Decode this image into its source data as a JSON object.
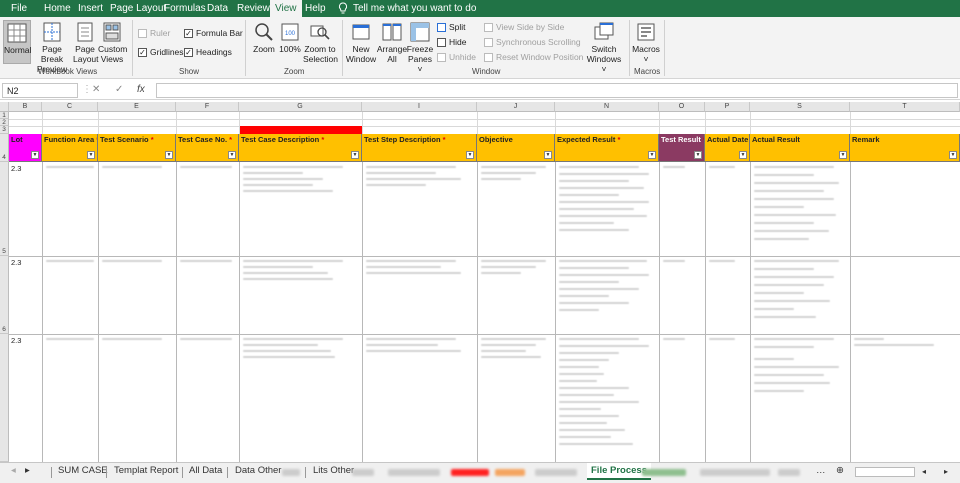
{
  "menu": {
    "file": "File",
    "home": "Home",
    "insert": "Insert",
    "page_layout": "Page Layout",
    "formulas": "Formulas",
    "data": "Data",
    "review": "Review",
    "view": "View",
    "help": "Help",
    "tell_me": "Tell me what you want to do"
  },
  "ribbon": {
    "workbook_views": {
      "label": "Workbook Views",
      "normal": "Normal",
      "page_break_1": "Page Break",
      "page_break_2": "Preview",
      "page_layout_1": "Page",
      "page_layout_2": "Layout",
      "custom_1": "Custom",
      "custom_2": "Views"
    },
    "show": {
      "label": "Show",
      "ruler": "Ruler",
      "formula_bar": "Formula Bar",
      "gridlines": "Gridlines",
      "headings": "Headings"
    },
    "zoom": {
      "label": "Zoom",
      "zoom": "Zoom",
      "hundred": "100%",
      "zoom_sel_1": "Zoom to",
      "zoom_sel_2": "Selection"
    },
    "window": {
      "label": "Window",
      "new_window_1": "New",
      "new_window_2": "Window",
      "arrange_1": "Arrange",
      "arrange_2": "All",
      "freeze_1": "Freeze",
      "freeze_2": "Panes",
      "split": "Split",
      "hide": "Hide",
      "unhide": "Unhide",
      "side_by_side": "View Side by Side",
      "sync_scroll": "Synchronous Scrolling",
      "reset_pos": "Reset Window Position",
      "switch_1": "Switch",
      "switch_2": "Windows"
    },
    "macros": {
      "label": "Macros",
      "macros": "Macros"
    }
  },
  "formula_bar": {
    "name_box": "N2",
    "cancel": "✕",
    "enter": "✓",
    "fx": "fx"
  },
  "columns": [
    "B",
    "C",
    "E",
    "F",
    "G",
    "I",
    "J",
    "N",
    "O",
    "P",
    "S",
    "T"
  ],
  "rows": [
    "1",
    "2",
    "3",
    "4",
    "5",
    "6"
  ],
  "headers": {
    "lot": "Lot",
    "function_area": "Function Area",
    "test_scenario": "Test Scenario",
    "test_case_no": "Test Case No.",
    "test_case_desc": "Test Case Description",
    "test_step_desc": "Test Step Description",
    "objective": "Objective",
    "expected_result": "Expected Result",
    "test_result": "Test Result",
    "actual_date": "Actual Date",
    "actual_result": "Actual Result",
    "remark": "Remark",
    "star": "*"
  },
  "lot_values": [
    "2.3",
    "2.3",
    "2.3"
  ],
  "sheets": {
    "sum_case": "SUM CASE",
    "templat_report": "Templat Report",
    "all_data": "All Data",
    "data_other": "Data Other",
    "lits_other": "Lits Other",
    "file_process": "File Process"
  },
  "colors": {
    "excel_green": "#217346",
    "header_yellow": "#ffc000",
    "lot_magenta": "#ff00ff",
    "test_result_purple": "#8b3a62",
    "red_marker": "#ff0000"
  }
}
